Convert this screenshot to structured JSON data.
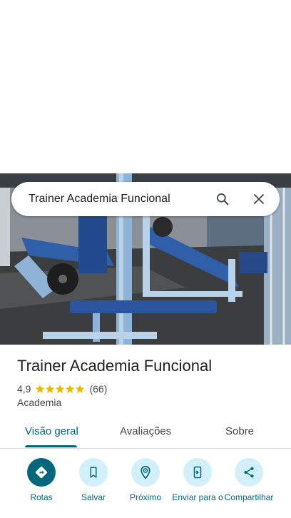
{
  "search": {
    "query": "Trainer Academia Funcional"
  },
  "place": {
    "name": "Trainer Academia Funcional",
    "rating": "4,9",
    "stars": 5,
    "review_count": "(66)",
    "category": "Academia"
  },
  "tabs": [
    {
      "label": "Visão geral",
      "active": true
    },
    {
      "label": "Avaliações",
      "active": false
    },
    {
      "label": "Sobre",
      "active": false
    }
  ],
  "actions": [
    {
      "label": "Rotas",
      "icon": "directions-icon"
    },
    {
      "label": "Salvar",
      "icon": "bookmark-icon"
    },
    {
      "label": "Próximo",
      "icon": "nearby-icon"
    },
    {
      "label": "Enviar para o",
      "icon": "send-to-phone-icon"
    },
    {
      "label": "Compartilhar",
      "icon": "share-icon"
    }
  ],
  "colors": {
    "accent": "#00677d",
    "button_bg": "#d2f0fb",
    "star": "#f6b400"
  }
}
